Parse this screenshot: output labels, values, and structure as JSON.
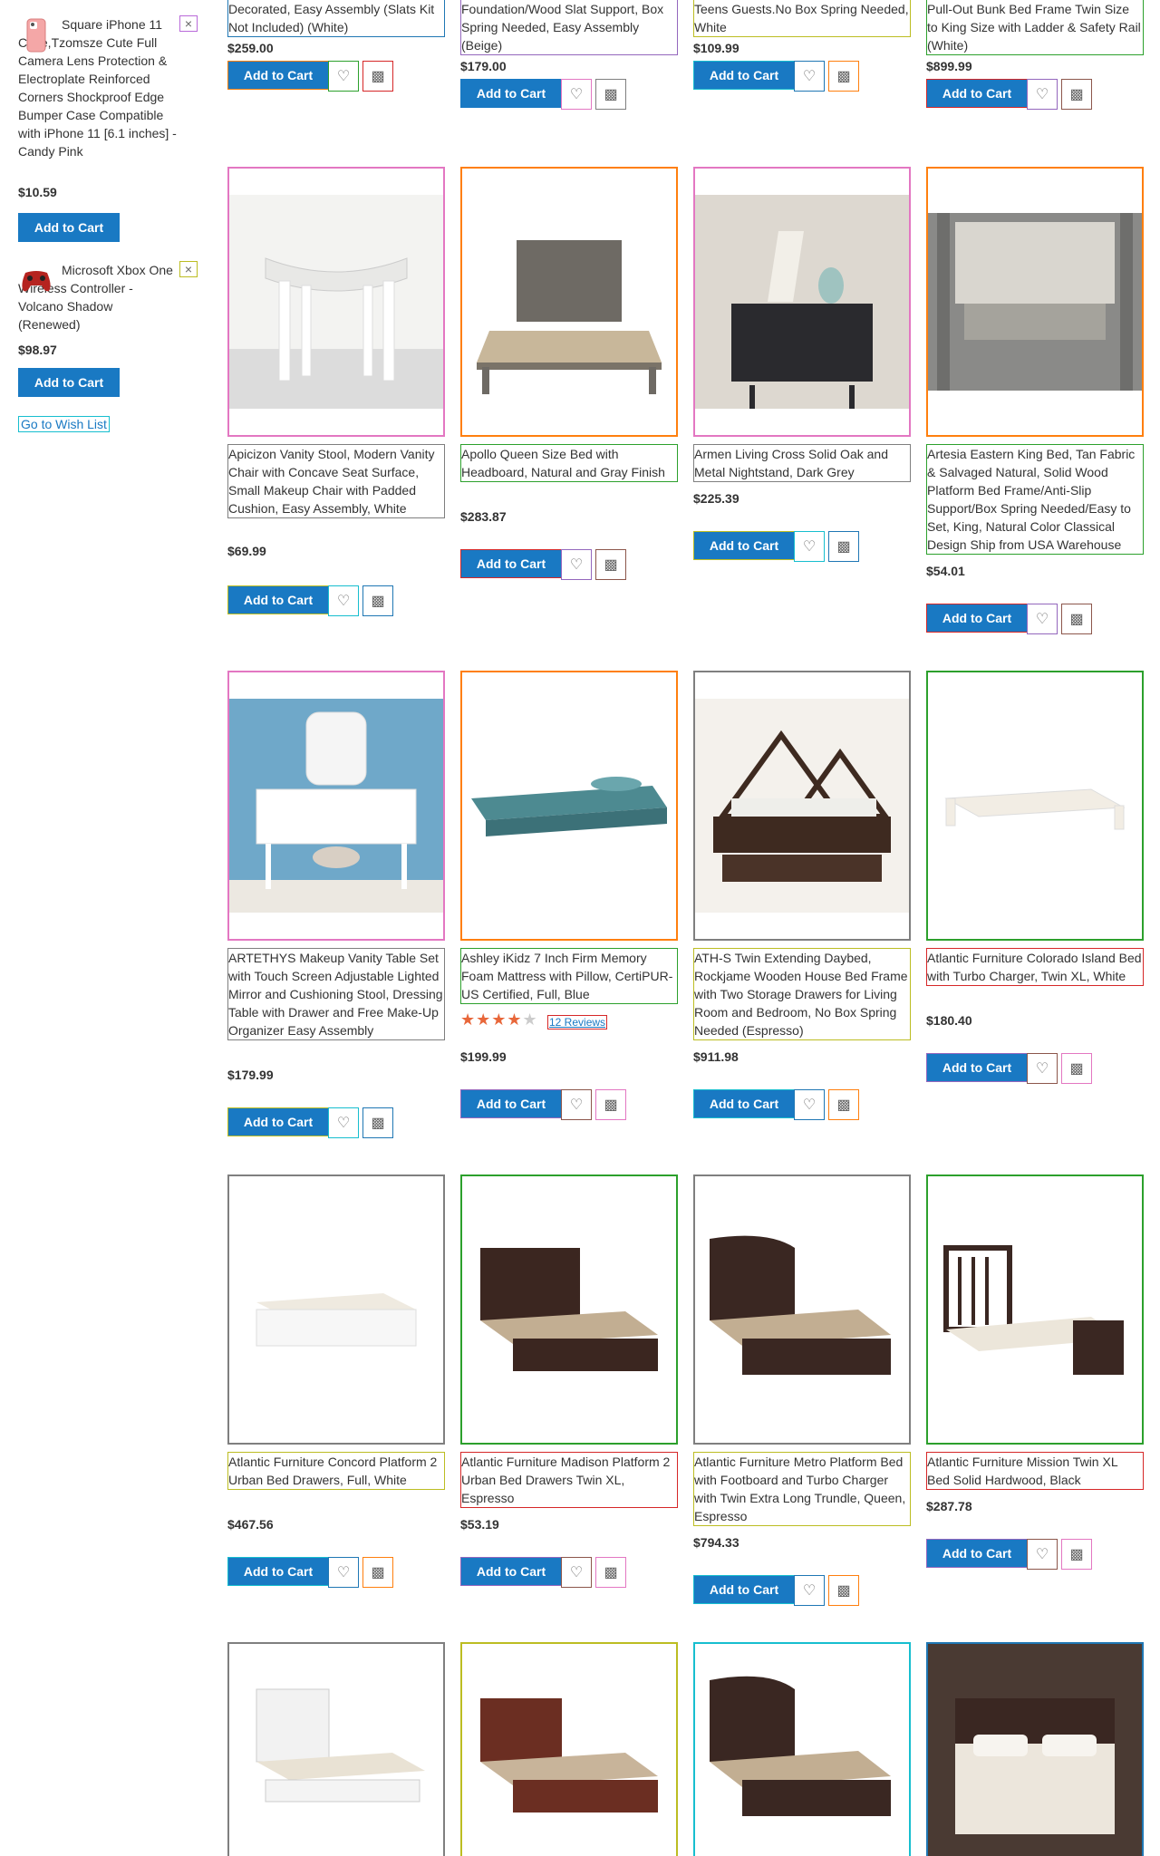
{
  "sidebar": {
    "items": [
      {
        "name": "Square iPhone 11 Case,Tzomsze Cute Full Camera Lens Protection & Electroplate Reinforced Corners Shockproof Edge Bumper Case Compatible with iPhone 11 [6.1 inches] - Candy Pink",
        "price": "$10.59",
        "cart_label": "Add to Cart",
        "close_label": "×",
        "thumb_icon": "phone-case-thumbnail",
        "thumb_color": "#f4a7a7"
      },
      {
        "name": "Microsoft Xbox One Wireless Controller - Volcano Shadow (Renewed)",
        "price": "$98.97",
        "cart_label": "Add to Cart",
        "close_label": "×",
        "thumb_icon": "controller-thumbnail",
        "thumb_color": "#b5231f"
      }
    ],
    "wish_list_link": "Go to Wish List"
  },
  "products": {
    "row0": [
      {
        "name": "Decorated, Easy Assembly (Slats Kit Not Included) (White)",
        "price": "$259.00",
        "cart": "Add to Cart"
      },
      {
        "name": "Foundation/Wood Slat Support, Box Spring Needed, Easy Assembly (Beige)",
        "price": "$179.00",
        "cart": "Add to Cart"
      },
      {
        "name": "Teens Guests.No Box Spring Needed, White",
        "price": "$109.99",
        "cart": "Add to Cart"
      },
      {
        "name": "Pull-Out Bunk Bed Frame Twin Size to King Size with Ladder & Safety Rail (White)",
        "price": "$899.99",
        "cart": "Add to Cart"
      }
    ],
    "row1": [
      {
        "name": "Apicizon Vanity Stool, Modern Vanity Chair with Concave Seat Surface, Small Makeup Chair with Padded Cushion, Easy Assembly, White",
        "price": "$69.99",
        "cart": "Add to Cart"
      },
      {
        "name": "Apollo Queen Size Bed with Headboard, Natural and Gray Finish",
        "price": "$283.87",
        "cart": "Add to Cart"
      },
      {
        "name": "Armen Living Cross Solid Oak and Metal Nightstand, Dark Grey",
        "price": "$225.39",
        "cart": "Add to Cart"
      },
      {
        "name": "Artesia Eastern King Bed, Tan Fabric & Salvaged Natural, Solid Wood Platform Bed Frame/Anti-Slip Support/Box Spring Needed/Easy to Set, King, Natural Color Classical Design Ship from USA Warehouse",
        "price": "$54.01",
        "cart": "Add to Cart"
      }
    ],
    "row2": [
      {
        "name": "ARTETHYS Makeup Vanity Table Set with Touch Screen Adjustable Lighted Mirror and Cushioning Stool, Dressing Table with Drawer and Free Make-Up Organizer Easy Assembly",
        "price": "$179.99",
        "cart": "Add to Cart"
      },
      {
        "name": "Ashley iKidz 7 Inch Firm Memory Foam Mattress with Pillow, CertiPUR-US Certified, Full, Blue",
        "price": "$199.99",
        "cart": "Add to Cart",
        "rating": 4,
        "reviews": "12  Reviews"
      },
      {
        "name": "ATH-S Twin Extending Daybed, Rockjame Wooden House Bed Frame with Two Storage Drawers for Living Room and Bedroom, No Box Spring Needed (Espresso)",
        "price": "$911.98",
        "cart": "Add to Cart"
      },
      {
        "name": "Atlantic Furniture Colorado Island Bed with Turbo Charger, Twin XL, White",
        "price": "$180.40",
        "cart": "Add to Cart"
      }
    ],
    "row3": [
      {
        "name": "Atlantic Furniture Concord Platform 2 Urban Bed Drawers, Full, White",
        "price": "$467.56",
        "cart": "Add to Cart"
      },
      {
        "name": "Atlantic Furniture Madison Platform 2 Urban Bed Drawers Twin XL, Espresso",
        "price": "$53.19",
        "cart": "Add to Cart"
      },
      {
        "name": "Atlantic Furniture Metro Platform Bed with Footboard and Turbo Charger with Twin Extra Long Trundle, Queen, Espresso",
        "price": "$794.33",
        "cart": "Add to Cart"
      },
      {
        "name": "Atlantic Furniture Mission Twin XL Bed Solid Hardwood, Black",
        "price": "$287.78",
        "cart": "Add to Cart"
      }
    ]
  },
  "icons": {
    "wishlist": "heart-icon",
    "compare": "bar-chart-icon"
  },
  "colors": {
    "accent": "#1979c3",
    "rating": "#e8673a"
  }
}
